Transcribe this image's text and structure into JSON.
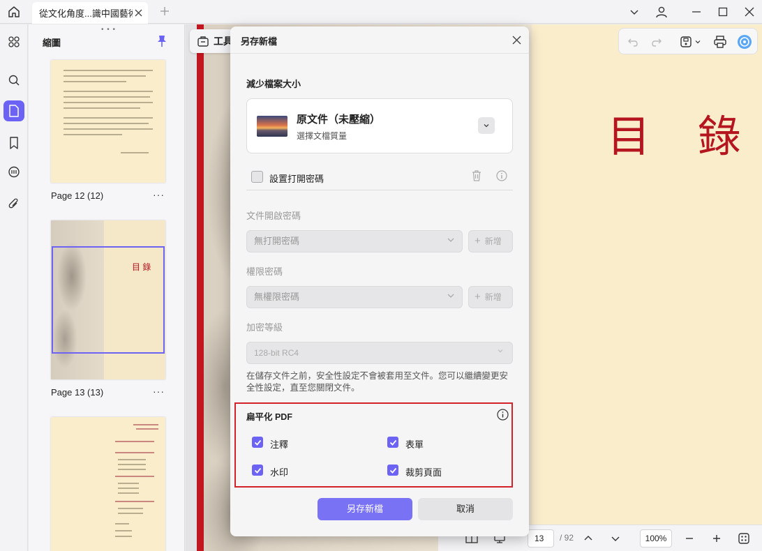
{
  "titlebar": {
    "tab_label": "從文化角度...識中國藝術"
  },
  "sidebar": {
    "panel_title": "縮圖",
    "pages": [
      {
        "label": "Page 12 (12)"
      },
      {
        "label": "Page 13 (13)"
      },
      {
        "label": ""
      }
    ],
    "thumb13_text": "目 錄",
    "more": "···"
  },
  "document": {
    "heading": "目 錄",
    "tools_label": "工具"
  },
  "bottombar": {
    "page_current": "13",
    "page_total": "/ 92",
    "zoom": "100%"
  },
  "dialog": {
    "title": "另存新檔",
    "reduce_title": "減少檔案大小",
    "quality_title": "原文件（未壓縮）",
    "quality_sub": "選擇文檔質量",
    "open_pw_checkbox": "設置打開密碼",
    "doc_open_pw_label": "文件開啟密碼",
    "doc_open_pw_value": "無打開密碼",
    "add_label": "新增",
    "perm_pw_label": "權限密碼",
    "perm_pw_value": "無權限密碼",
    "enc_label": "加密等級",
    "enc_value": "128-bit RC4",
    "note": "在儲存文件之前，安全性設定不會被套用至文件。您可以繼續變更安全性設定，直至您關閉文件。",
    "flatten_title": "扁平化 PDF",
    "flatten_options": {
      "annotations": "注釋",
      "forms": "表單",
      "watermark": "水印",
      "crop": "裁剪頁面"
    },
    "save_button": "另存新檔",
    "cancel_button": "取消"
  },
  "colors": {
    "accent": "#6c63f5",
    "highlight_border": "#d42229",
    "doc_red": "#b5151f"
  }
}
